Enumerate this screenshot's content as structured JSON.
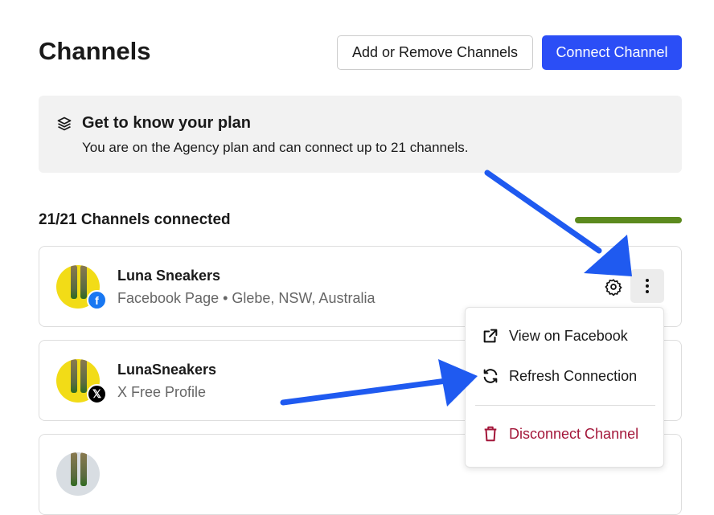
{
  "header": {
    "title": "Channels",
    "add_remove_label": "Add or Remove Channels",
    "connect_label": "Connect Channel"
  },
  "plan": {
    "title": "Get to know your plan",
    "description": "You are on the Agency plan and can connect up to 21 channels."
  },
  "channels_connected": {
    "label": "21/21 Channels connected",
    "fraction": 1.0,
    "color": "#5c8a1e"
  },
  "channels": [
    {
      "name": "Luna Sneakers",
      "subtitle": "Facebook Page • Glebe, NSW, Australia",
      "network": "facebook"
    },
    {
      "name": "LunaSneakers",
      "subtitle": "X Free Profile",
      "network": "x"
    }
  ],
  "menu": {
    "items": [
      {
        "label": "View on Facebook",
        "icon": "external-link-icon"
      },
      {
        "label": "Refresh Connection",
        "icon": "refresh-icon"
      },
      {
        "label": "Disconnect Channel",
        "icon": "trash-icon",
        "color": "#a3173a"
      }
    ]
  },
  "colors": {
    "accent": "#2b4ef6",
    "annotation_arrow": "#1f5af0"
  }
}
